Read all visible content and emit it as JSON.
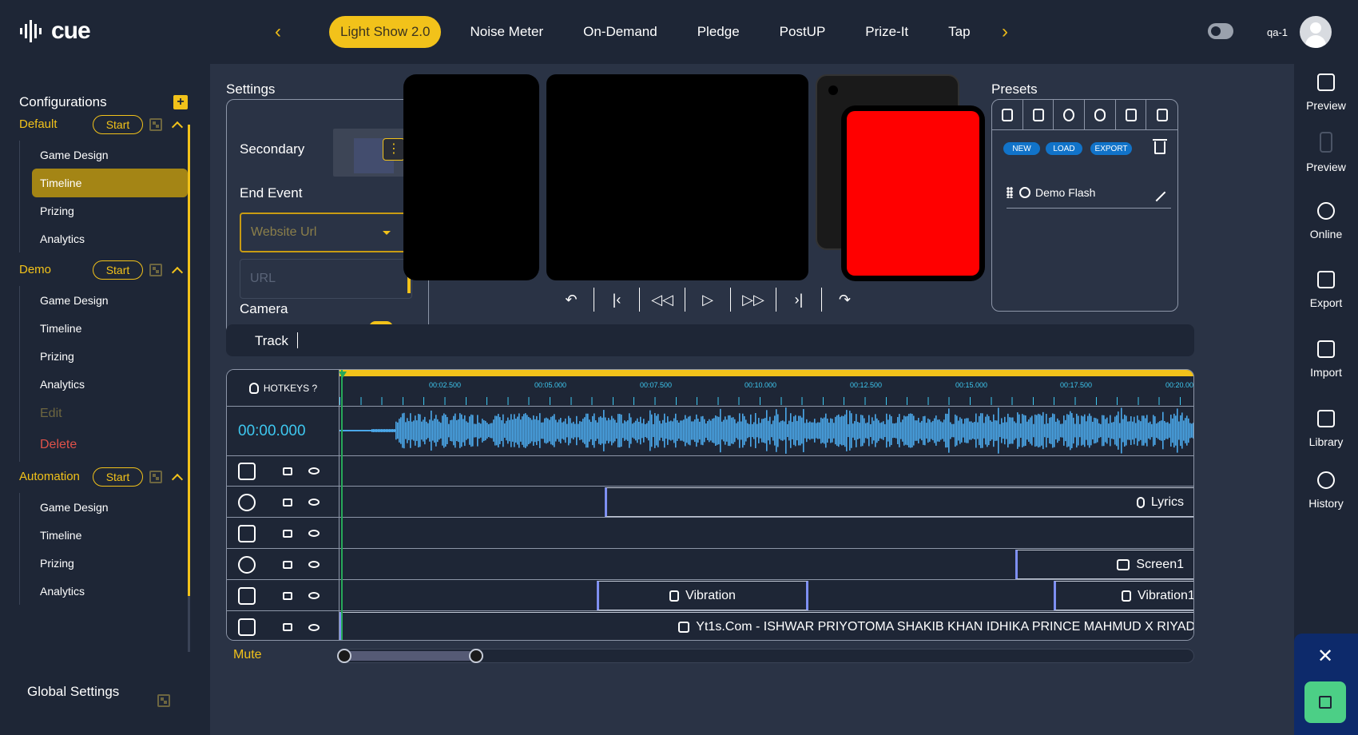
{
  "app": {
    "logo_text": "cue",
    "user_name": "qa-1"
  },
  "top_tabs": [
    {
      "label": "Light Show 2.0",
      "active": true
    },
    {
      "label": "Noise Meter"
    },
    {
      "label": "On-Demand"
    },
    {
      "label": "Pledge"
    },
    {
      "label": "PostUP"
    },
    {
      "label": "Prize-It"
    },
    {
      "label": "Tap"
    }
  ],
  "sidebar": {
    "title": "Configurations",
    "groups": [
      {
        "name": "Default",
        "start_label": "Start",
        "items": [
          "Game Design",
          "Timeline",
          "Prizing",
          "Analytics"
        ],
        "active_item": "Timeline"
      },
      {
        "name": "Demo",
        "start_label": "Start",
        "items": [
          "Game Design",
          "Timeline",
          "Prizing",
          "Analytics",
          "Edit",
          "Delete"
        ]
      },
      {
        "name": "Automation",
        "start_label": "Start",
        "items": [
          "Game Design",
          "Timeline",
          "Prizing",
          "Analytics"
        ]
      }
    ],
    "global_settings": "Global Settings"
  },
  "right_bar": [
    {
      "label": "Preview",
      "icon": "preview-icon"
    },
    {
      "label": "Preview",
      "icon": "preview-mobile-icon"
    },
    {
      "label": "Online",
      "icon": "broadcast-icon"
    },
    {
      "label": "Export",
      "icon": "export-icon"
    },
    {
      "label": "Import",
      "icon": "import-icon"
    },
    {
      "label": "Library",
      "icon": "book-icon"
    },
    {
      "label": "History",
      "icon": "history-icon"
    }
  ],
  "settings": {
    "title": "Settings",
    "secondary_label": "Secondary",
    "end_event_label": "End Event",
    "end_event_placeholder": "Website Url",
    "url_placeholder": "URL",
    "camera_label": "Camera"
  },
  "presets": {
    "title": "Presets",
    "new_label": "NEW",
    "load_label": "LOAD",
    "export_label": "EXPORT",
    "items": [
      {
        "name": "Demo Flash"
      }
    ]
  },
  "track": {
    "label": "Track"
  },
  "timeline": {
    "hotkeys_label": "HOTKEYS ?",
    "time": "00:00.000",
    "ruler_labels": [
      "00:02.500",
      "00:05.000",
      "00:07.500",
      "00:10.000",
      "00:12.500",
      "00:15.000",
      "00:17.500",
      "00:20.00"
    ],
    "clips": {
      "lyrics": "Lyrics",
      "screen": "Screen1",
      "vibration_a": "Vibration",
      "vibration_b": "Vibration1",
      "audio": "Yt1s.Com - ISHWAR PRIYOTOMA SHAKIB KHAN IDHIKA PRINCE MAHMUD X RIYAD"
    },
    "mute_label": "Mute"
  },
  "colors": {
    "accent": "#f2c21a",
    "background": "#1e2636",
    "panel": "#2a3345",
    "timecode": "#3ec7ef",
    "waveform": "#4ba8ea",
    "preview_red": "#ff0000"
  }
}
